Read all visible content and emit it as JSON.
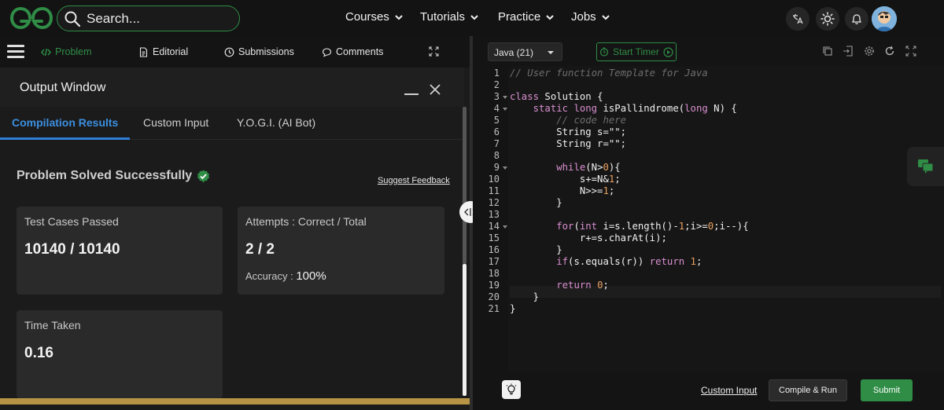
{
  "header": {
    "search": {
      "placeholder": "Search..."
    },
    "nav": [
      {
        "label": "Courses"
      },
      {
        "label": "Tutorials"
      },
      {
        "label": "Practice"
      },
      {
        "label": "Jobs"
      }
    ],
    "icons": [
      "translate-icon",
      "theme-toggle-icon",
      "notification-bell-icon",
      "user-avatar"
    ]
  },
  "problem_tabs": [
    {
      "label": "Problem",
      "active": true,
      "icon": "code-icon"
    },
    {
      "label": "Editorial",
      "icon": "document-icon"
    },
    {
      "label": "Submissions",
      "icon": "clock-icon"
    },
    {
      "label": "Comments",
      "icon": "comment-icon"
    }
  ],
  "output": {
    "title": "Output Window",
    "tabs": [
      {
        "label": "Compilation Results",
        "active": true
      },
      {
        "label": "Custom Input"
      },
      {
        "label": "Y.O.G.I. (AI Bot)"
      }
    ],
    "status": "Problem Solved Successfully",
    "feedback_link": "Suggest Feedback",
    "cards": {
      "test_cases": {
        "label": "Test Cases Passed",
        "value": "10140 / 10140"
      },
      "attempts": {
        "label": "Attempts : Correct / Total",
        "value": "2 / 2",
        "accuracy_label": "Accuracy :",
        "accuracy_value": "100%"
      },
      "time": {
        "label": "Time Taken",
        "value": "0.16"
      }
    }
  },
  "editor": {
    "language": "Java (21)",
    "timer_label": "Start Timer",
    "line_numbers": [
      "1",
      "2",
      "3",
      "4",
      "5",
      "6",
      "7",
      "8",
      "9",
      "10",
      "11",
      "12",
      "13",
      "14",
      "15",
      "16",
      "17",
      "18",
      "19",
      "20",
      "21"
    ],
    "footer": {
      "custom_input": "Custom Input",
      "compile_run": "Compile & Run",
      "submit": "Submit"
    }
  },
  "colors": {
    "brand_green": "#2f8d46",
    "active_tab_blue": "#2f7ed8",
    "background": "#131313"
  }
}
